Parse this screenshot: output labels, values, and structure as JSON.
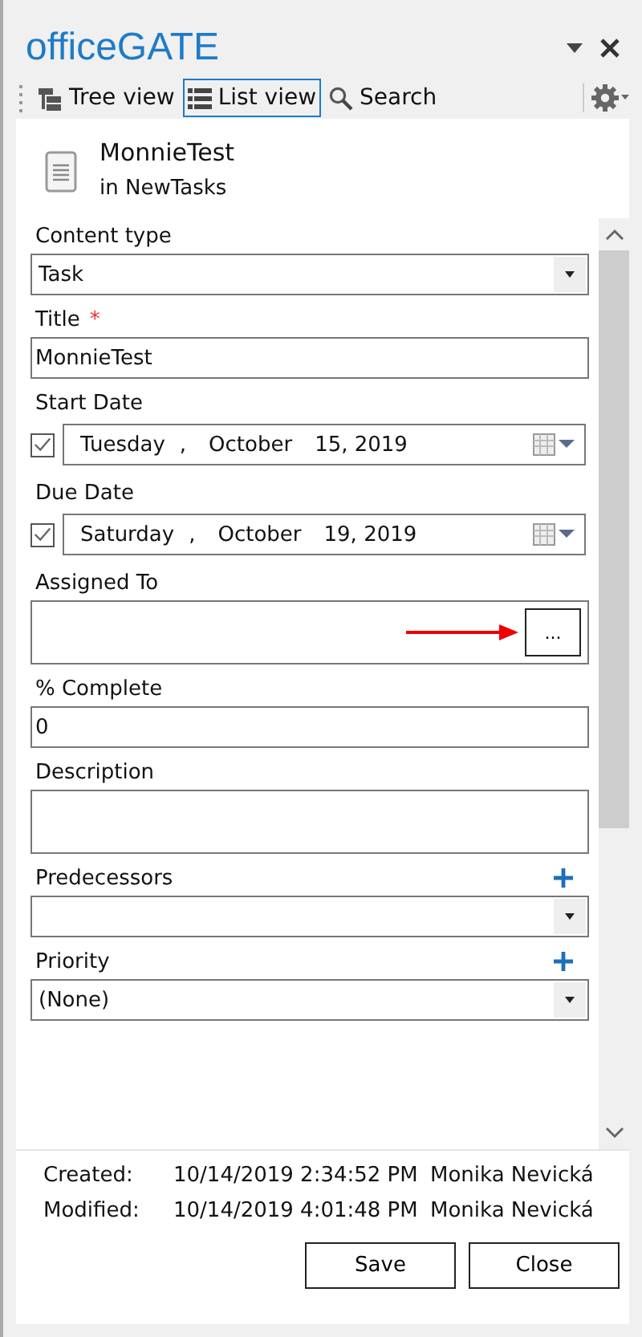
{
  "pane": {
    "title": "officeGATE"
  },
  "toolbar": {
    "tabs": [
      {
        "label": "Tree view",
        "selected": false
      },
      {
        "label": "List view",
        "selected": true
      },
      {
        "label": "Search",
        "selected": false
      }
    ]
  },
  "item": {
    "name": "MonnieTest",
    "location": "in NewTasks"
  },
  "fields": [
    {
      "kind": "select",
      "label": "Content type",
      "value": "Task"
    },
    {
      "kind": "text",
      "label": "Title",
      "required_mark": "*",
      "value": "MonnieTest"
    },
    {
      "kind": "date",
      "label": "Start Date",
      "checked": true,
      "parts": [
        "Tuesday",
        ",",
        "October",
        "15, 2019"
      ]
    },
    {
      "kind": "date",
      "label": "Due Date",
      "checked": true,
      "parts": [
        "Saturday",
        ",",
        "October",
        "19, 2019"
      ]
    },
    {
      "kind": "people",
      "label": "Assigned To",
      "button": "...",
      "arrow": true
    },
    {
      "kind": "text",
      "label": "% Complete",
      "value": "0"
    },
    {
      "kind": "textarea",
      "label": "Description"
    },
    {
      "kind": "select",
      "label": "Predecessors",
      "addable": true
    },
    {
      "kind": "select",
      "label": "Priority",
      "addable": true,
      "value": "(None)"
    }
  ],
  "meta": [
    {
      "label": "Created:",
      "time": "10/14/2019 2:34:52 PM",
      "user": "Monika Nevická"
    },
    {
      "label": "Modified:",
      "time": "10/14/2019 4:01:48 PM",
      "user": "Monika Nevická"
    }
  ],
  "buttons": [
    "Save",
    "Close"
  ]
}
